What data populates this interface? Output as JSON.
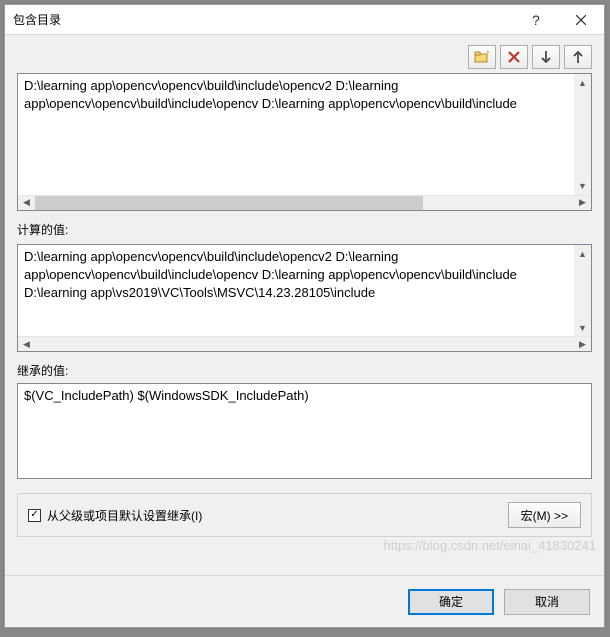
{
  "title": "包含目录",
  "toolbar": {
    "new_folder": "new-folder-icon",
    "delete": "delete-icon",
    "move_down": "arrow-down-icon",
    "move_up": "arrow-up-icon"
  },
  "editable_paths": [
    "D:\\learning app\\opencv\\opencv\\build\\include\\opencv2",
    "D:\\learning app\\opencv\\opencv\\build\\include\\opencv",
    "D:\\learning app\\opencv\\opencv\\build\\include"
  ],
  "computed_label": "计算的值:",
  "computed_paths": [
    "D:\\learning app\\opencv\\opencv\\build\\include\\opencv2",
    "D:\\learning app\\opencv\\opencv\\build\\include\\opencv",
    "D:\\learning app\\opencv\\opencv\\build\\include",
    "D:\\learning app\\vs2019\\VC\\Tools\\MSVC\\14.23.28105\\include"
  ],
  "inherited_label": "继承的值:",
  "inherited_paths": [
    "$(VC_IncludePath)",
    "$(WindowsSDK_IncludePath)"
  ],
  "inherit_checkbox": {
    "checked": true,
    "label": "从父级或项目默认设置继承(I)"
  },
  "macro_button": "宏(M) >>",
  "buttons": {
    "ok": "确定",
    "cancel": "取消"
  },
  "watermark": "https://blog.csdn.net/einai_41830241"
}
